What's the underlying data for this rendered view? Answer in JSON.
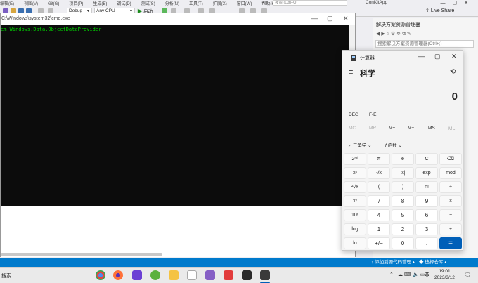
{
  "vs": {
    "menu": [
      "编辑(E)",
      "视图(V)",
      "Git(G)",
      "项目(P)",
      "生成(B)",
      "调试(D)",
      "测试(S)",
      "分析(N)",
      "工具(T)",
      "扩展(X)",
      "窗口(W)",
      "帮助(H)"
    ],
    "search_placeholder": "搜索 (Ctrl+Q)",
    "app_name": "ConKitApp",
    "config": "Debug",
    "platform": "Any CPU",
    "run_label": "启动",
    "live_share": "Live Share",
    "solution_explorer": {
      "title": "解决方案资源管理器",
      "search_placeholder": "搜索解决方案资源管理器(Ctrl+;)"
    },
    "status": {
      "git_label": "添加到源代码管理",
      "repo_label": "选择仓库"
    }
  },
  "cmd": {
    "title": "C:\\Windows\\system32\\cmd.exe",
    "output": "em.Windows.Data.ObjectDataProvider"
  },
  "calc": {
    "title": "计算器",
    "mode": "科学",
    "display": "0",
    "angle": "DEG",
    "fe": "F-E",
    "memory": [
      {
        "label": "MC",
        "enabled": false
      },
      {
        "label": "MR",
        "enabled": false
      },
      {
        "label": "M+",
        "enabled": true
      },
      {
        "label": "M−",
        "enabled": true
      },
      {
        "label": "MS",
        "enabled": true
      },
      {
        "label": "M⌄",
        "enabled": false
      }
    ],
    "trig_label": "三角学",
    "func_label": "函数",
    "keys": [
      [
        "2ⁿᵈ",
        "π",
        "e",
        "C",
        "⌫"
      ],
      [
        "x²",
        "¹/x",
        "|x|",
        "exp",
        "mod"
      ],
      [
        "²√x",
        "(",
        ")",
        "n!",
        "÷"
      ],
      [
        "xʸ",
        "7",
        "8",
        "9",
        "×"
      ],
      [
        "10ˣ",
        "4",
        "5",
        "6",
        "−"
      ],
      [
        "log",
        "1",
        "2",
        "3",
        "+"
      ],
      [
        "ln",
        "+/−",
        "0",
        ".",
        "="
      ]
    ]
  },
  "taskbar": {
    "search_label": "搜索",
    "ime": "英",
    "time": "19:01",
    "date": "2023/3/12"
  }
}
